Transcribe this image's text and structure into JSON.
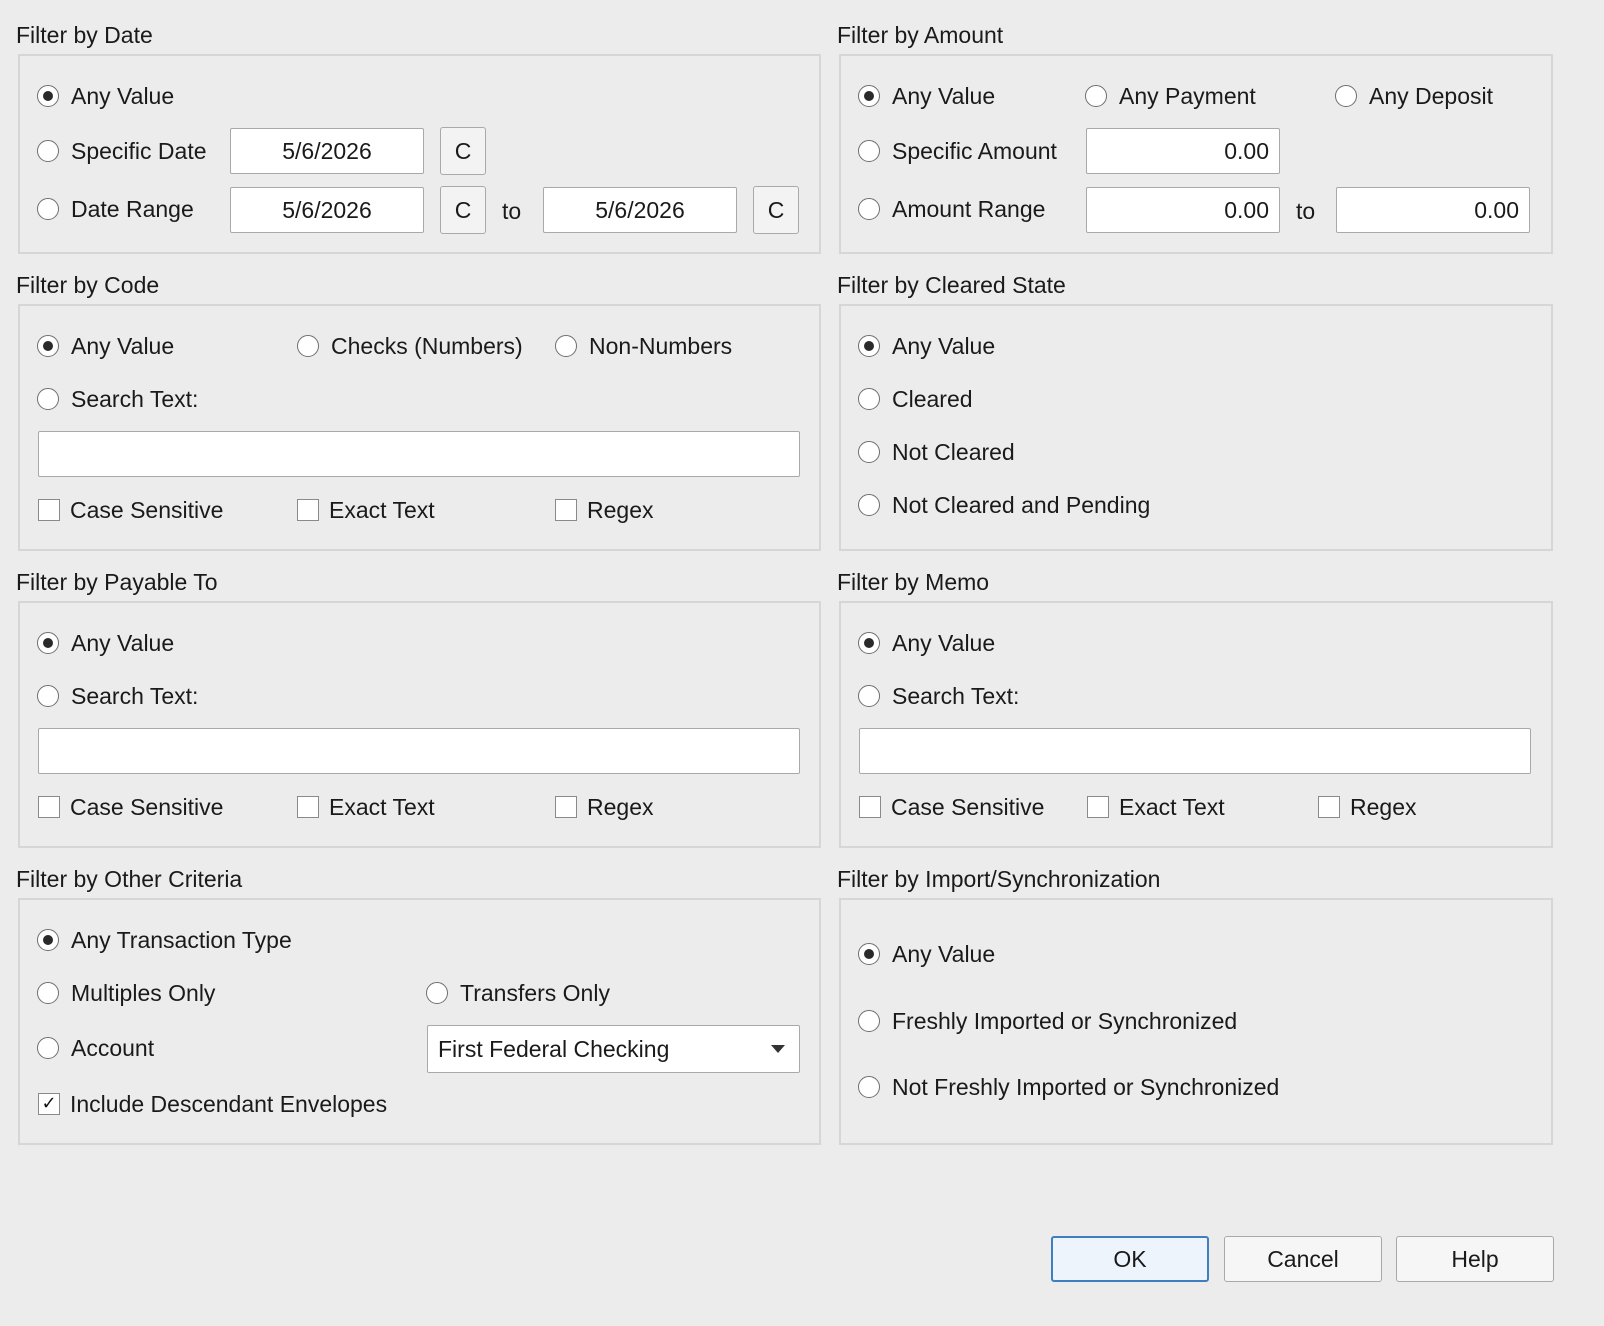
{
  "date": {
    "title": "Filter by Date",
    "any": "Any Value",
    "specific": "Specific Date",
    "range": "Date Range",
    "specific_value": "5/6/2026",
    "range_from": "5/6/2026",
    "range_to": "5/6/2026",
    "cal_label": "C",
    "to": "to"
  },
  "amount": {
    "title": "Filter by Amount",
    "any": "Any Value",
    "payment": "Any Payment",
    "deposit": "Any Deposit",
    "specific": "Specific Amount",
    "range": "Amount Range",
    "specific_value": "0.00",
    "range_from": "0.00",
    "range_to": "0.00",
    "to": "to"
  },
  "code": {
    "title": "Filter by Code",
    "any": "Any Value",
    "checks": "Checks (Numbers)",
    "non_numbers": "Non-Numbers",
    "search": "Search Text:",
    "search_value": "",
    "case_sensitive": "Case Sensitive",
    "exact_text": "Exact Text",
    "regex": "Regex"
  },
  "cleared": {
    "title": "Filter by Cleared State",
    "any": "Any Value",
    "cleared": "Cleared",
    "not_cleared": "Not Cleared",
    "not_cleared_pending": "Not Cleared and Pending"
  },
  "payable": {
    "title": "Filter by Payable To",
    "any": "Any Value",
    "search": "Search Text:",
    "search_value": "",
    "case_sensitive": "Case Sensitive",
    "exact_text": "Exact Text",
    "regex": "Regex"
  },
  "memo": {
    "title": "Filter by Memo",
    "any": "Any Value",
    "search": "Search Text:",
    "search_value": "",
    "case_sensitive": "Case Sensitive",
    "exact_text": "Exact Text",
    "regex": "Regex"
  },
  "other": {
    "title": "Filter by Other Criteria",
    "any_type": "Any Transaction Type",
    "multiples": "Multiples Only",
    "transfers": "Transfers Only",
    "account": "Account",
    "account_value": "First Federal Checking",
    "include_descendants": "Include Descendant Envelopes",
    "include_descendants_checked": true
  },
  "import": {
    "title": "Filter by Import/Synchronization",
    "any": "Any Value",
    "fresh": "Freshly Imported or Synchronized",
    "not_fresh": "Not Freshly Imported or Synchronized"
  },
  "buttons": {
    "ok": "OK",
    "cancel": "Cancel",
    "help": "Help"
  },
  "colors": {
    "background": "#ececec",
    "default_button_border": "#3f7fc0"
  }
}
